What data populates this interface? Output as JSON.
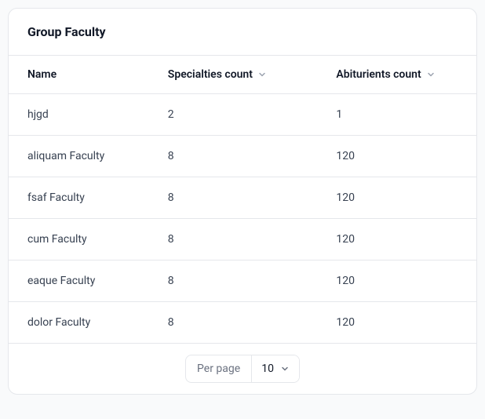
{
  "card": {
    "title": "Group Faculty"
  },
  "table": {
    "headers": {
      "name": "Name",
      "specialties": "Specialties count",
      "abiturients": "Abiturients count"
    },
    "rows": [
      {
        "name": "hjgd",
        "specialties": "2",
        "abiturients": "1"
      },
      {
        "name": "aliquam Faculty",
        "specialties": "8",
        "abiturients": "120"
      },
      {
        "name": "fsaf Faculty",
        "specialties": "8",
        "abiturients": "120"
      },
      {
        "name": "cum Faculty",
        "specialties": "8",
        "abiturients": "120"
      },
      {
        "name": "eaque Faculty",
        "specialties": "8",
        "abiturients": "120"
      },
      {
        "name": "dolor Faculty",
        "specialties": "8",
        "abiturients": "120"
      }
    ]
  },
  "pagination": {
    "per_page_label": "Per page",
    "per_page_value": "10"
  }
}
